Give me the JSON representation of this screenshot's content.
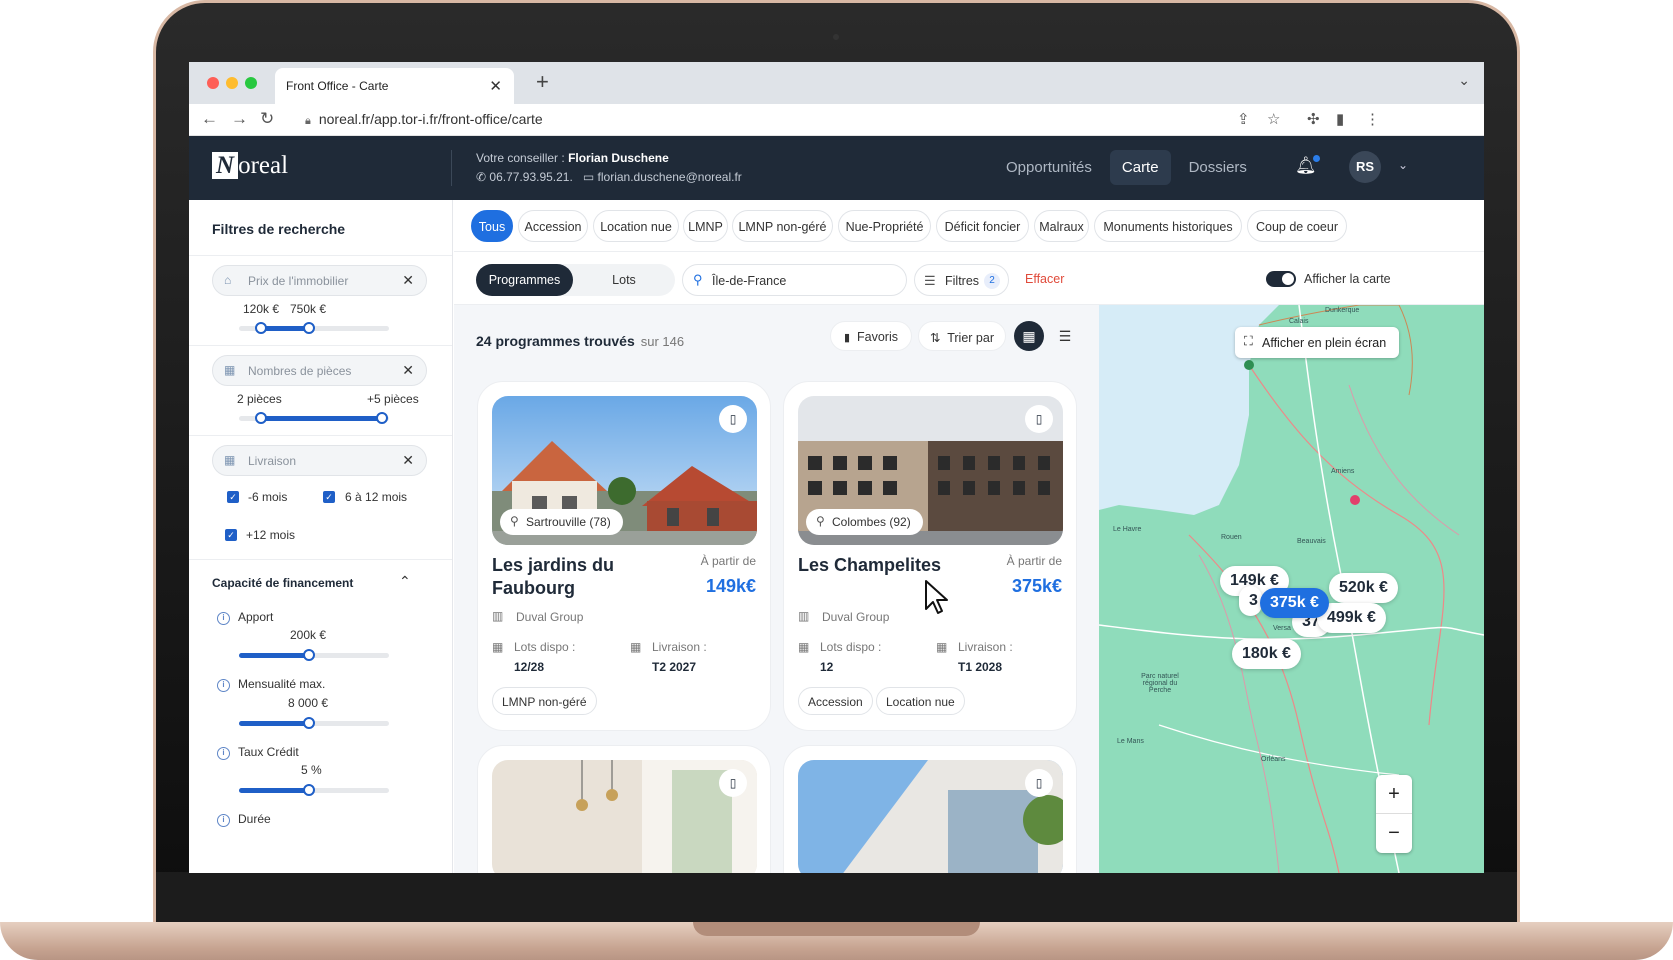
{
  "browser": {
    "tab_title": "Front Office - Carte",
    "url": "noreal.fr/app.tor-i.fr/front-office/carte"
  },
  "header": {
    "logo": "Noreal",
    "advisor_prefix": "Votre conseiller :",
    "advisor_name": "Florian Duschene",
    "advisor_phone": "06.77.93.95.21.",
    "advisor_email": "florian.duschene@noreal.fr",
    "nav": [
      "Opportunités",
      "Carte",
      "Dossiers"
    ],
    "active_nav": "Carte",
    "avatar_initials": "RS"
  },
  "sidebar": {
    "title": "Filtres de recherche",
    "price": {
      "placeholder": "Prix de l'immobilier",
      "min_label": "120k €",
      "max_label": "750k €"
    },
    "rooms": {
      "placeholder": "Nombres de pièces",
      "min_label": "2 pièces",
      "max_label": "+5 pièces"
    },
    "delivery": {
      "placeholder": "Livraison",
      "options": [
        "-6 mois",
        "6 à 12 mois",
        "+12 mois"
      ]
    },
    "financing": {
      "title": "Capacité de financement",
      "apport": {
        "label": "Apport",
        "value": "200k €"
      },
      "mensualite": {
        "label": "Mensualité max.",
        "value": "8 000 €"
      },
      "taux": {
        "label": "Taux Crédit",
        "value": "5 %"
      },
      "duree": {
        "label": "Durée"
      }
    }
  },
  "categories": [
    "Tous",
    "Accession",
    "Location nue",
    "LMNP",
    "LMNP non-géré",
    "Nue-Propriété",
    "Déficit foncier",
    "Malraux",
    "Monuments historiques",
    "Coup de coeur"
  ],
  "toolbar": {
    "segment": [
      "Programmes",
      "Lots"
    ],
    "location": "Île-de-France",
    "filters_label": "Filtres",
    "filters_count": "2",
    "clear_label": "Effacer",
    "map_toggle_label": "Afficher la carte"
  },
  "results": {
    "count_label": "24 programmes trouvés",
    "total_label": "sur 146",
    "favoris": "Favoris",
    "sort": "Trier par"
  },
  "cards": [
    {
      "city": "Sartrouville (78)",
      "title": "Les jardins du Faubourg",
      "from": "À partir de",
      "price": "149k€",
      "developer": "Duval Group",
      "lots_label": "Lots dispo :",
      "lots": "12/28",
      "delivery_label": "Livraison :",
      "delivery": "T2 2027",
      "tags": [
        "LMNP non-géré"
      ]
    },
    {
      "city": "Colombes (92)",
      "title": "Les Champelites",
      "from": "À partir de",
      "price": "375k€",
      "developer": "Duval Group",
      "lots_label": "Lots dispo :",
      "lots": "12",
      "delivery_label": "Livraison :",
      "delivery": "T1 2028",
      "tags": [
        "Accession",
        "Location nue"
      ]
    }
  ],
  "map": {
    "fullscreen": "Afficher en plein écran",
    "prices": [
      "149k €",
      "375k €",
      "520k €",
      "499k €",
      "180k €",
      "3",
      "375"
    ],
    "towns": [
      "Dunkerque",
      "Calais",
      "Amiens",
      "Le Havre",
      "Rouen",
      "Beauvais",
      "Versa",
      "Parc naturel régional du Perche",
      "Le Mans",
      "Orléans"
    ]
  }
}
